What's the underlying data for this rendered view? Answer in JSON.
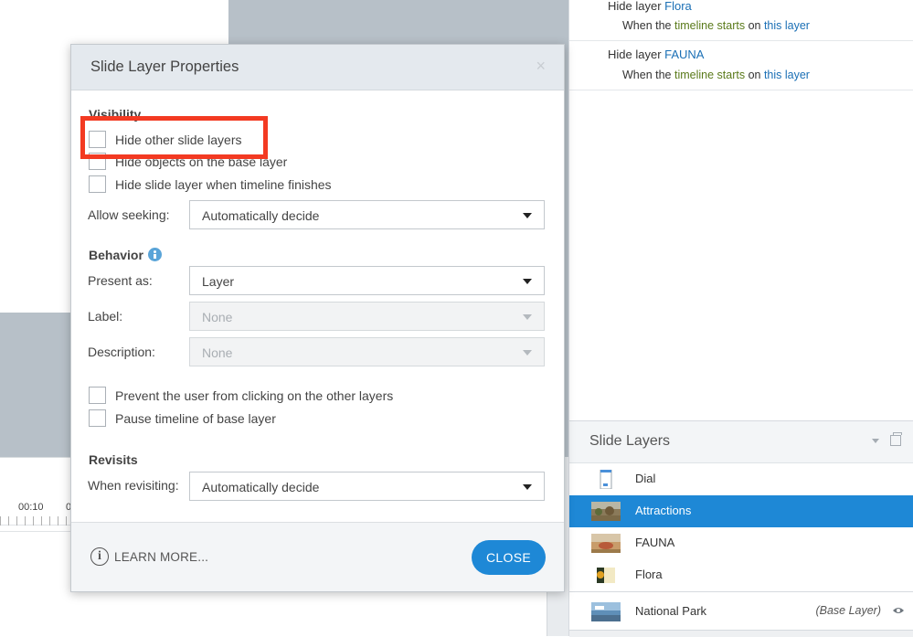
{
  "timeline": {
    "tick_label": "00:10",
    "tick_label_cut": "0"
  },
  "triggers": [
    {
      "action": "Hide layer ",
      "target": "Flora",
      "cond_prefix": "When the ",
      "cond_event": "timeline starts",
      "cond_mid": " on ",
      "cond_object": "this layer"
    },
    {
      "action": "Hide layer ",
      "target": "FAUNA",
      "cond_prefix": "When the ",
      "cond_event": "timeline starts",
      "cond_mid": " on ",
      "cond_object": "this layer"
    }
  ],
  "layers_panel": {
    "title": "Slide Layers",
    "items": [
      {
        "name": "Dial",
        "selected": false
      },
      {
        "name": "Attractions",
        "selected": true
      },
      {
        "name": "FAUNA",
        "selected": false
      },
      {
        "name": "Flora",
        "selected": false
      }
    ],
    "base": {
      "name": "National Park",
      "tag": "(Base Layer)"
    }
  },
  "dialog": {
    "title": "Slide Layer Properties",
    "close_glyph": "×",
    "visibility": {
      "title": "Visibility",
      "checkboxes": [
        "Hide other slide layers",
        "Hide objects on the base layer",
        "Hide slide layer when timeline finishes"
      ],
      "allow_seeking_label": "Allow seeking:",
      "allow_seeking_value": "Automatically decide"
    },
    "behavior": {
      "title": "Behavior",
      "present_as_label": "Present as:",
      "present_as_value": "Layer",
      "label_label": "Label:",
      "label_value": "None",
      "description_label": "Description:",
      "description_value": "None",
      "checkboxes": [
        "Prevent the user from clicking on the other layers",
        "Pause timeline of base layer"
      ]
    },
    "revisits": {
      "title": "Revisits",
      "when_label": "When revisiting:",
      "when_value": "Automatically decide"
    },
    "footer": {
      "info_glyph": "i",
      "learn_more": "LEARN MORE...",
      "close": "CLOSE"
    }
  },
  "colors": {
    "accent": "#1e88d6",
    "highlight": "#f33a22",
    "stage": "#b7c0c8"
  }
}
